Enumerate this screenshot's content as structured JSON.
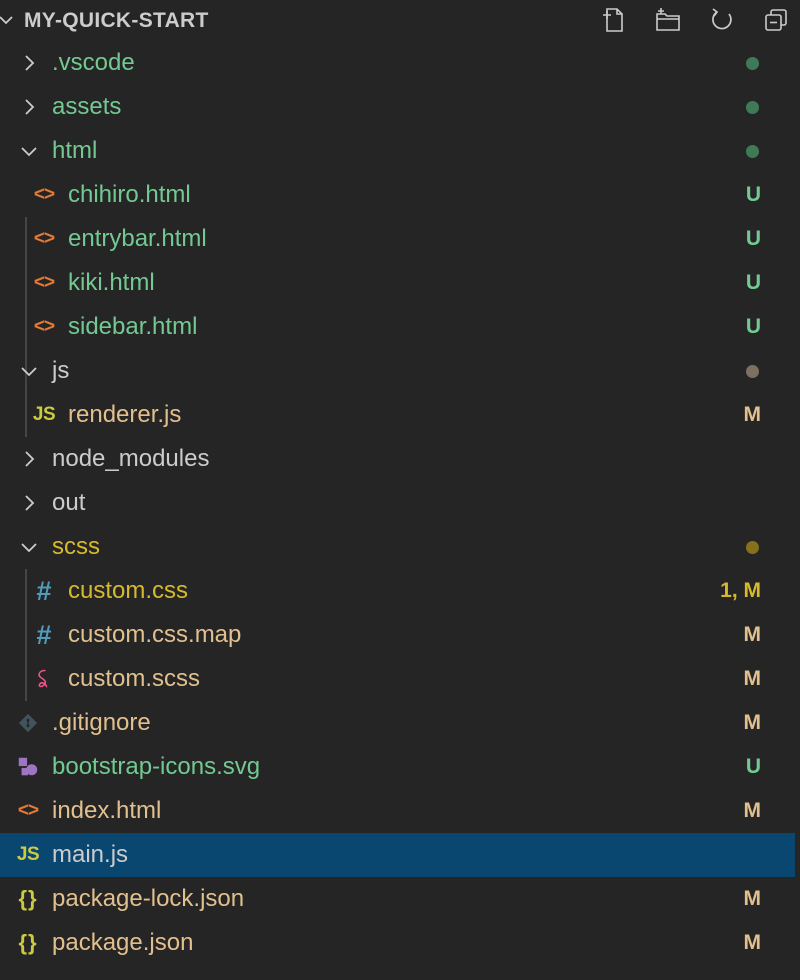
{
  "header": {
    "title": "MY-QUICK-START",
    "actions": [
      "new-file-icon",
      "new-folder-icon",
      "refresh-icon",
      "collapse-all-icon"
    ]
  },
  "colors": {
    "background": "#252526",
    "selected": "#094771",
    "added": "#73c991",
    "modified": "#e2c08d",
    "warning": "#d7ba2b",
    "dot_green": "#3f7a57",
    "dot_brown": "#7e7060",
    "dot_ochre": "#86701b"
  },
  "tree": [
    {
      "label": ".vscode",
      "type": "folder",
      "expanded": false,
      "depth": 0,
      "status": "",
      "dot": "green"
    },
    {
      "label": "assets",
      "type": "folder",
      "expanded": false,
      "depth": 0,
      "status": "",
      "dot": "green"
    },
    {
      "label": "html",
      "type": "folder",
      "expanded": true,
      "depth": 0,
      "status": "",
      "dot": "green"
    },
    {
      "label": "chihiro.html",
      "type": "file",
      "icon": "html-icon",
      "depth": 1,
      "status": "U"
    },
    {
      "label": "entrybar.html",
      "type": "file",
      "icon": "html-icon",
      "depth": 1,
      "status": "U"
    },
    {
      "label": "kiki.html",
      "type": "file",
      "icon": "html-icon",
      "depth": 1,
      "status": "U"
    },
    {
      "label": "sidebar.html",
      "type": "file",
      "icon": "html-icon",
      "depth": 1,
      "status": "U"
    },
    {
      "label": "js",
      "type": "folder",
      "expanded": true,
      "depth": 0,
      "status": "",
      "dot": "brown"
    },
    {
      "label": "renderer.js",
      "type": "file",
      "icon": "js-icon",
      "depth": 1,
      "status": "M"
    },
    {
      "label": "node_modules",
      "type": "folder",
      "expanded": false,
      "depth": 0,
      "status": ""
    },
    {
      "label": "out",
      "type": "folder",
      "expanded": false,
      "depth": 0,
      "status": ""
    },
    {
      "label": "scss",
      "type": "folder",
      "expanded": true,
      "depth": 0,
      "status": "",
      "dot": "ochre"
    },
    {
      "label": "custom.css",
      "type": "file",
      "icon": "css-icon",
      "depth": 1,
      "status": "1, M"
    },
    {
      "label": "custom.css.map",
      "type": "file",
      "icon": "css-icon",
      "depth": 1,
      "status": "M"
    },
    {
      "label": "custom.scss",
      "type": "file",
      "icon": "sass-icon",
      "depth": 1,
      "status": "M"
    },
    {
      "label": ".gitignore",
      "type": "file",
      "icon": "git-icon",
      "depth": 0,
      "status": "M"
    },
    {
      "label": "bootstrap-icons.svg",
      "type": "file",
      "icon": "svg-icon",
      "depth": 0,
      "status": "U"
    },
    {
      "label": "index.html",
      "type": "file",
      "icon": "html-icon",
      "depth": 0,
      "status": "M"
    },
    {
      "label": "main.js",
      "type": "file",
      "icon": "js-icon",
      "depth": 0,
      "status": "",
      "selected": true
    },
    {
      "label": "package-lock.json",
      "type": "file",
      "icon": "json-icon",
      "depth": 0,
      "status": "M"
    },
    {
      "label": "package.json",
      "type": "file",
      "icon": "json-icon",
      "depth": 0,
      "status": "M"
    }
  ]
}
